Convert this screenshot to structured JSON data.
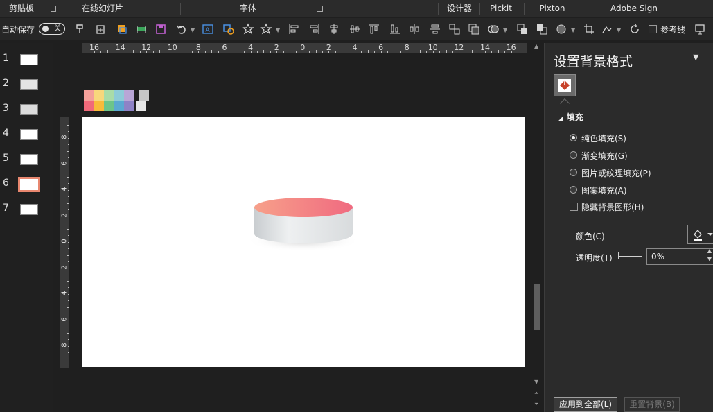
{
  "ribbon": {
    "groups": [
      {
        "label": "剪贴板"
      },
      {
        "label": "在线幻灯片"
      },
      {
        "label": "字体"
      },
      {
        "label": "设计器"
      },
      {
        "label": "Pickit"
      },
      {
        "label": "Pixton"
      },
      {
        "label": "Adobe Sign"
      }
    ]
  },
  "qat": {
    "autosave_label": "自动保存",
    "autosave_state": "关",
    "guides_label": "参考线",
    "icons": [
      "format-painter-icon",
      "new-slide-icon",
      "image-edit-icon",
      "green-arrange-icon",
      "save-icon",
      "undo-icon",
      "text-box-icon",
      "shapes-icon",
      "star-icon",
      "star-outline-icon",
      "align-left-icon",
      "align-right-icon",
      "align-center-icon",
      "distribute-icon",
      "align-top-icon",
      "align-bottom-icon",
      "distribute-vertical-icon",
      "align-middle-icon",
      "group-icon",
      "ungroup-icon",
      "merge-shapes-icon",
      "bring-forward-icon",
      "send-backward-icon",
      "shape-fill-icon",
      "crop-icon",
      "selection-pane-icon",
      "rotate-icon",
      "present-icon"
    ]
  },
  "ruler": {
    "h_labels": [
      "16",
      "14",
      "12",
      "10",
      "8",
      "6",
      "4",
      "2",
      "0",
      "2",
      "4",
      "6",
      "8",
      "10",
      "12",
      "14",
      "16"
    ],
    "v_labels": [
      "8",
      "6",
      "4",
      "2",
      "0",
      "2",
      "4",
      "6",
      "8"
    ]
  },
  "thumbnails": [
    {
      "num": "1"
    },
    {
      "num": "2"
    },
    {
      "num": "3"
    },
    {
      "num": "4"
    },
    {
      "num": "5"
    },
    {
      "num": "6"
    },
    {
      "num": "7"
    }
  ],
  "palette": {
    "top": [
      "#f4a09a",
      "#f8d77c",
      "#a9dca8",
      "#8dcbd8",
      "#b9a6d6"
    ],
    "bottom": [
      "#f06a7a",
      "#f8bb3a",
      "#6cc58a",
      "#5aa9d2",
      "#8e82c6"
    ],
    "gray_top": "#c7c7c7",
    "gray_bottom": "#e7e7e7"
  },
  "pane": {
    "title": "设置背景格式",
    "section": "填充",
    "options": [
      {
        "label": "纯色填充(S)",
        "selected": true
      },
      {
        "label": "渐变填充(G)",
        "selected": false
      },
      {
        "label": "图片或纹理填充(P)",
        "selected": false
      },
      {
        "label": "图案填充(A)",
        "selected": false
      }
    ],
    "hide_bg_label": "隐藏背景图形(H)",
    "color_label": "颜色(C)",
    "transparency_label": "透明度(T)",
    "transparency_value": "0%",
    "apply_all_label": "应用到全部(L)",
    "reset_label": "重置背景(B)"
  },
  "colors": {
    "accent_active_thumb": "#e8876f",
    "fill_tab_icon": "#c8432b",
    "cylinder_top_start": "#f7a08a",
    "cylinder_top_end": "#f06a80"
  }
}
